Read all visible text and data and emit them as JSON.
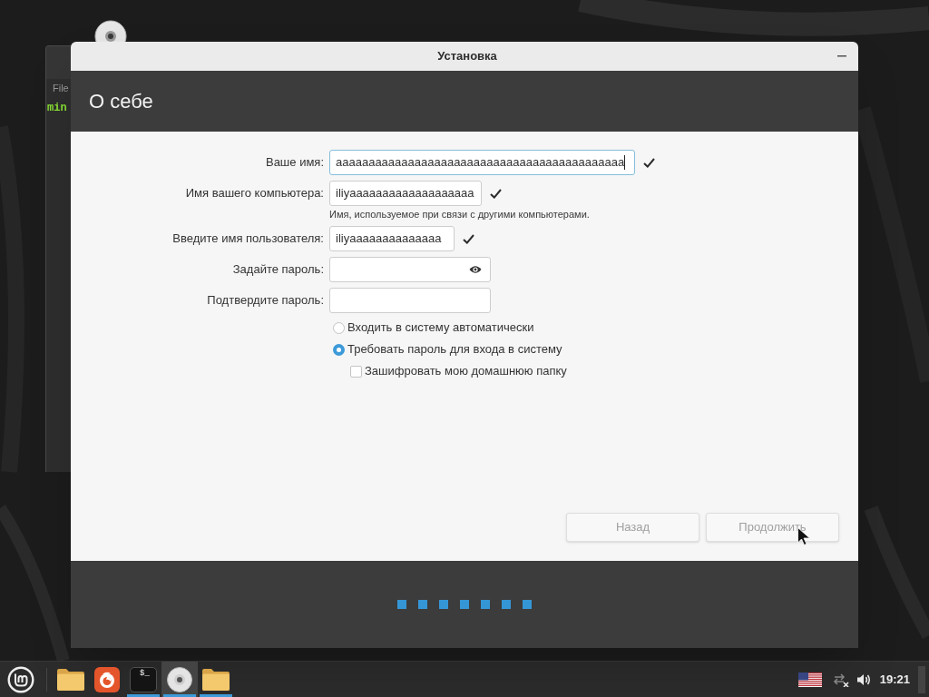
{
  "desktop": {
    "background_window": {
      "menu": "File",
      "prompt": "min"
    }
  },
  "window": {
    "title": "Установка",
    "heading": "О себе"
  },
  "form": {
    "fields": [
      {
        "kind": "text",
        "label": "Ваше имя:",
        "value": "aaaaaaaaaaaaaaaaaaaaaaaaaaaaaaaaaaaaaaaaaaaa",
        "focused": true,
        "valid": true
      },
      {
        "kind": "text",
        "label": "Имя вашего компьютера:",
        "value": "iliyaaaaaaaaaaaaaaaaaaa",
        "focused": false,
        "valid": true,
        "hint": "Имя, используемое при связи с другими компьютерами."
      },
      {
        "kind": "text",
        "label": "Введите имя пользователя:",
        "value": "iliyaaaaaaaaaaaaaa",
        "focused": false,
        "valid": true
      },
      {
        "kind": "password",
        "label": "Задайте пароль:",
        "focused": false,
        "valid": false,
        "reveal_toggle": true
      },
      {
        "kind": "password",
        "label": "Подтвердите пароль:",
        "focused": false,
        "valid": false
      }
    ],
    "login_options": [
      {
        "label": "Входить в систему автоматически",
        "selected": false
      },
      {
        "label": "Требовать пароль для входа в систему",
        "selected": true
      }
    ],
    "encrypt_home": {
      "label": "Зашифровать мою домашнюю папку",
      "checked": false
    }
  },
  "buttons": [
    {
      "label": "Назад",
      "disabled": true
    },
    {
      "label": "Продолжить",
      "disabled": true
    }
  ],
  "progress": {
    "steps": [
      {
        "done": true
      },
      {
        "done": true
      },
      {
        "done": true
      },
      {
        "done": true
      },
      {
        "done": true
      },
      {
        "done": true
      },
      {
        "done": true
      }
    ]
  },
  "taskbar": {
    "apps": [
      {
        "kind": "folder",
        "running": false,
        "selected": false
      },
      {
        "kind": "browser",
        "running": false,
        "selected": false
      },
      {
        "kind": "terminal",
        "glyph": "$_",
        "running": true,
        "selected": false
      },
      {
        "kind": "disc",
        "running": true,
        "selected": true
      },
      {
        "kind": "folder",
        "running": true,
        "selected": false
      }
    ],
    "clock": "19:21"
  }
}
